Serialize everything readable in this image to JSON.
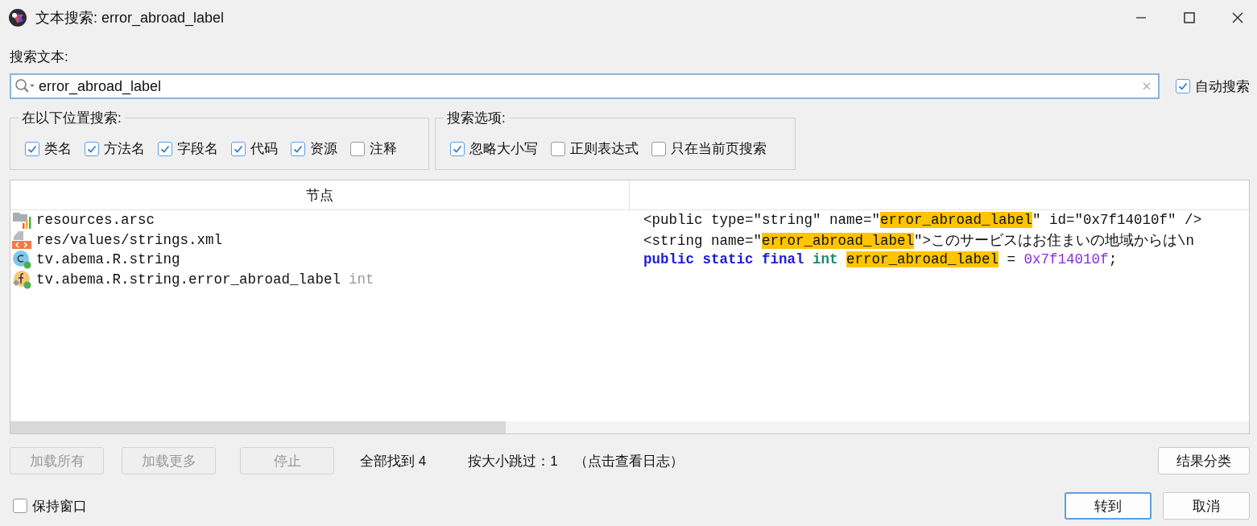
{
  "window": {
    "title": "文本搜索: error_abroad_label"
  },
  "search": {
    "label": "搜索文本:",
    "value": "error_abroad_label",
    "auto_search": {
      "label": "自动搜索",
      "checked": true
    }
  },
  "search_in": {
    "title": "在以下位置搜索:",
    "options": [
      {
        "label": "类名",
        "checked": true
      },
      {
        "label": "方法名",
        "checked": true
      },
      {
        "label": "字段名",
        "checked": true
      },
      {
        "label": "代码",
        "checked": true
      },
      {
        "label": "资源",
        "checked": true
      },
      {
        "label": "注释",
        "checked": false
      }
    ]
  },
  "search_options": {
    "title": "搜索选项:",
    "options": [
      {
        "label": "忽略大小写",
        "checked": true
      },
      {
        "label": "正则表达式",
        "checked": false
      },
      {
        "label": "只在当前页搜索",
        "checked": false
      }
    ]
  },
  "table": {
    "columns": [
      "节点"
    ],
    "rows": [
      {
        "kind": "resource-table",
        "node": "resources.arsc",
        "code": [
          {
            "kind": "plain",
            "text": "<public type=\"string\" name=\""
          },
          {
            "kind": "match",
            "text": "error_abroad_label"
          },
          {
            "kind": "plain",
            "text": "\" id=\"0x7f14010f\" />"
          }
        ]
      },
      {
        "kind": "xml-file",
        "node": "res/values/strings.xml",
        "code": [
          {
            "kind": "plain",
            "text": "<string name=\""
          },
          {
            "kind": "match",
            "text": "error_abroad_label"
          },
          {
            "kind": "plain",
            "text": "\">このサービスはお住まいの地域からは\\n"
          }
        ]
      },
      {
        "kind": "class",
        "node": "tv.abema.R.string",
        "code": [
          {
            "kind": "keyword",
            "text": "public static final "
          },
          {
            "kind": "type",
            "text": "int "
          },
          {
            "kind": "match",
            "text": "error_abroad_label"
          },
          {
            "kind": "plain",
            "text": " = "
          },
          {
            "kind": "number",
            "text": "0x7f14010f"
          },
          {
            "kind": "plain",
            "text": ";"
          }
        ]
      },
      {
        "kind": "field",
        "node": "tv.abema.R.string.error_abroad_label",
        "type": "int"
      }
    ]
  },
  "actions": [
    {
      "label": "加载所有",
      "disabled": true
    },
    {
      "label": "加载更多",
      "disabled": true
    },
    {
      "label": "停止",
      "disabled": true
    }
  ],
  "status": {
    "found": "全部找到 4",
    "skipped": "按大小跳过：1",
    "log_link": "（点击查看日志）"
  },
  "group_button": "结果分类",
  "keep_window": {
    "label": "保持窗口",
    "checked": false
  },
  "buttons": [
    {
      "label": "转到",
      "default": true
    },
    {
      "label": "取消",
      "default": false
    }
  ]
}
